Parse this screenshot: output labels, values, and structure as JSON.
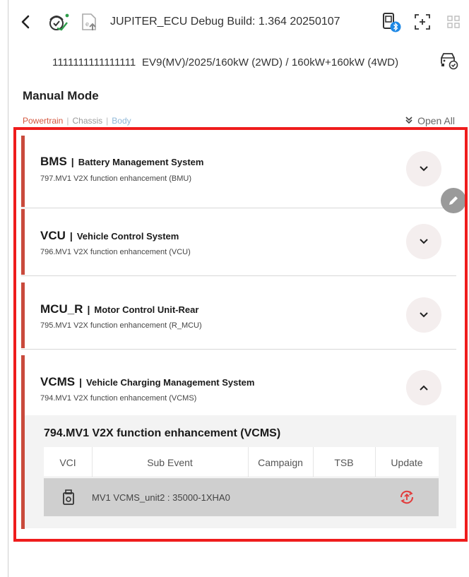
{
  "header": {
    "title": "JUPITER_ECU Debug Build: 1.364 20250107",
    "back_icon": "chevron-left-icon",
    "icons": [
      "vehicle-diagnostic-icon",
      "upload-file-icon",
      "vci-bluetooth-icon",
      "screenshot-icon",
      "grid-icon"
    ]
  },
  "vehicle": {
    "vin": "1111111111111111",
    "info": "EV9(MV)/2025/160kW (2WD) / 160kW+160kW (4WD)",
    "icon": "car-check-icon"
  },
  "page": {
    "title": "Manual Mode"
  },
  "filters": {
    "powertrain": "Powertrain",
    "chassis": "Chassis",
    "body": "Body",
    "separator": "|",
    "open_all": "Open All"
  },
  "modules": [
    {
      "code": "BMS",
      "name": "Battery Management System",
      "description": "797.MV1 V2X function enhancement (BMU)",
      "expanded": false
    },
    {
      "code": "VCU",
      "name": "Vehicle Control System",
      "description": "796.MV1 V2X function enhancement (VCU)",
      "expanded": false
    },
    {
      "code": "MCU_R",
      "name": "Motor Control Unit-Rear",
      "description": "795.MV1 V2X function enhancement (R_MCU)",
      "expanded": false
    },
    {
      "code": "VCMS",
      "name": "Vehicle Charging Management System",
      "description": "794.MV1 V2X function enhancement (VCMS)",
      "expanded": true
    }
  ],
  "detail": {
    "title": "794.MV1 V2X function enhancement (VCMS)",
    "columns": [
      "VCI",
      "Sub Event",
      "Campaign",
      "TSB",
      "Update"
    ],
    "rows": [
      {
        "sub_event": "MV1 VCMS_unit2 : 35000-1XHA0",
        "campaign": "",
        "tsb": "",
        "update_icon": "update-icon"
      }
    ]
  },
  "colors": {
    "accent": "#c94a3c",
    "highlight": "#ef1c1c",
    "update_icon": "#e23b3b",
    "bluetooth": "#1e88e5"
  }
}
